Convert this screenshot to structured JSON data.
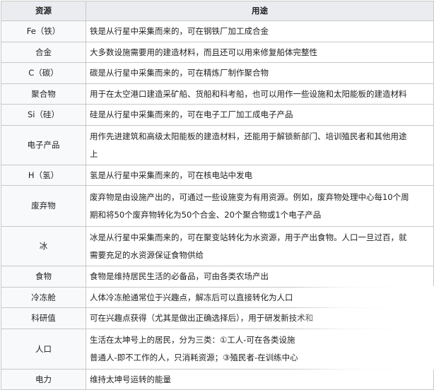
{
  "table": {
    "headers": [
      "资源",
      "用途"
    ],
    "rows": [
      {
        "name": "Fe（铁）",
        "use": [
          "铁是从行星中采集而来的，可在钢铁厂加工成合金"
        ]
      },
      {
        "name": "合金",
        "use": [
          "大多数设施需要用的建造材料，而且还可以用来修复船体完整性"
        ]
      },
      {
        "name": "C（碳）",
        "use": [
          "碳是从行星中采集而来的，可在精炼厂制作聚合物"
        ]
      },
      {
        "name": "聚合物",
        "use": [
          "用于在太空港口建造采矿船、货船和科考船，也可以用作一些设施和太阳能板的建造材料"
        ]
      },
      {
        "name": "Si（硅）",
        "use": [
          "硅是从行星中采集而来的，可在电子工厂加工成电子产品"
        ]
      },
      {
        "name": "电子产品",
        "use": [
          "用作先进建筑和高级太阳能板的建造材料，还能用于解锁新部门、培训殖民者和其他用途",
          "上"
        ]
      },
      {
        "name": "H（氢）",
        "use": [
          "氢是从行星中采集而来的，可在核电站中发电"
        ]
      },
      {
        "name": "废弃物",
        "use": [
          "废弃物是由设施产出的，可通过一些设施变为有用资源。例如，废弃物处理中心每10个周",
          "期和将50个废弃物转化为50个合金、20个聚合物或1个电子产品"
        ]
      },
      {
        "name": "冰",
        "use": [
          "冰是从行星中采集而来的，可在聚变站转化为水资源，用于产出食物。人口一旦过百，就",
          "需要充足的水资源保证食物供给"
        ]
      },
      {
        "name": "食物",
        "use": [
          "食物是维持居民生活的必备品，可由各类农场产出"
        ]
      },
      {
        "name": "冷冻舱",
        "use": [
          "人体冷冻舱通常位于兴趣点，解冻后可以直接转化为人口"
        ]
      },
      {
        "name": "科研值",
        "use": [
          "可在兴趣点获得（尤其是做出正确选择后），用于研发新技术和"
        ]
      },
      {
        "name": "人口",
        "use": [
          "生活在太坤号上的居民，分为三类：①工人-可在各类设施",
          "普通人-即不工作的人，只消耗资源；③殖民者-在训练中心"
        ]
      },
      {
        "name": "电力",
        "use": [
          "维持太坤号运转的能量"
        ]
      }
    ]
  }
}
